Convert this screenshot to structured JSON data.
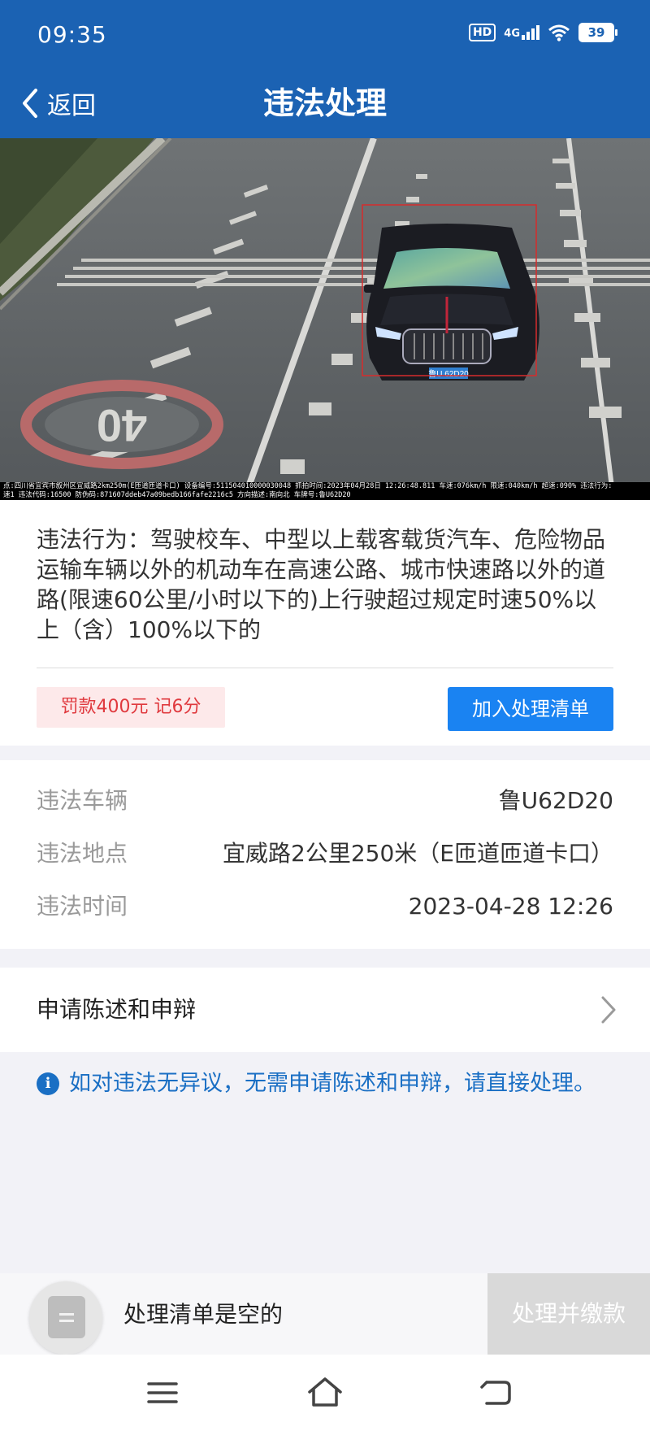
{
  "status_bar": {
    "time": "09:35",
    "hd": "HD",
    "network": "4G",
    "battery": "39",
    "icons": [
      "hd-icon",
      "cellular-signal-icon",
      "wifi-icon",
      "battery-icon"
    ]
  },
  "nav": {
    "back_label": "返回",
    "title": "违法处理",
    "back_icon": "chevron-left-icon"
  },
  "photo": {
    "plate": "鲁U 62D20",
    "speed_marking": "40",
    "caption_line1": "点:四川省宜宾市叙州区宜威路2km250m(E匝道匝道卡口) 设备编号:511504010000030048 抓拍时间:2023年04月28日 12:26:48.811 车速:076km/h 限速:040km/h 超速:090% 违法行为:",
    "caption_line2": "速1 违法代码:16500 防伪码:871607ddeb47a09bedb166fafe2216c5 方向描述:南向北 车牌号:鲁U62D20"
  },
  "violation": {
    "description": "违法行为：驾驶校车、中型以上载客载货汽车、危险物品运输车辆以外的机动车在高速公路、城市快速路以外的道路(限速60公里/小时以下的)上行驶超过规定时速50%以上（含）100%以下的",
    "penalty": "罚款400元 记6分",
    "add_button": "加入处理清单"
  },
  "details": {
    "rows": [
      {
        "label": "违法车辆",
        "value": "鲁U62D20"
      },
      {
        "label": "违法地点",
        "value": "宜威路2公里250米（E匝道匝道卡口）"
      },
      {
        "label": "违法时间",
        "value": "2023-04-28 12:26"
      }
    ]
  },
  "appeal": {
    "label": "申请陈述和申辩",
    "icon": "chevron-right-icon"
  },
  "notice": {
    "icon": "info-icon",
    "icon_glyph": "i",
    "text": "如对违法无异议，无需申请陈述和申辩，请直接处理。"
  },
  "bottom_bar": {
    "cart_icon": "list-icon",
    "empty_text": "处理清单是空的",
    "pay_button": "处理并缴款"
  },
  "system_nav": {
    "icons": [
      "menu-icon",
      "home-icon",
      "back-icon"
    ]
  },
  "colors": {
    "header": "#1b62b3",
    "accent": "#1a83f2",
    "penalty_text": "#e0393e",
    "penalty_bg": "#fde9ea",
    "notice_text": "#1a6fc4"
  }
}
